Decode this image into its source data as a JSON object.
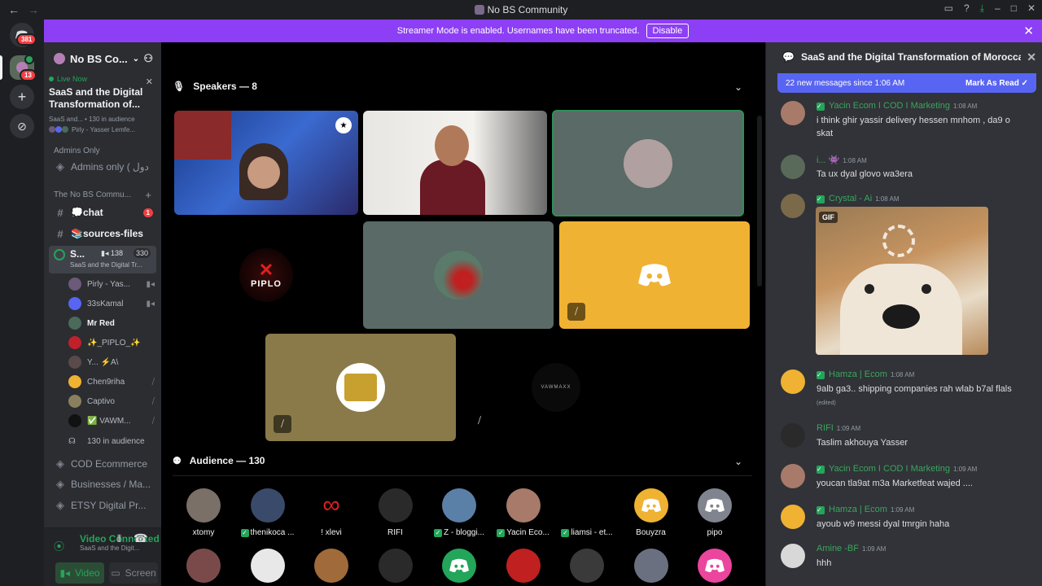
{
  "window": {
    "title": "No BS Community"
  },
  "banner": {
    "text": "Streamer Mode is enabled. Usernames have been truncated.",
    "disable_label": "Disable"
  },
  "guilds": {
    "home_badge": "381",
    "server_badge": "13"
  },
  "sidebar": {
    "server_name": "No BS Co...",
    "live_label": "Live Now",
    "stage_title": "SaaS and the Digital Transformation of...",
    "stage_meta_1": "SaaS and...",
    "stage_meta_audience": "130 in audience",
    "stage_meta_2": "Pirly - Yasser Lemfe...",
    "admins_cat": "Admins Only",
    "admins_channel": "Admins only ( ﺩﻭﻝ",
    "community_cat": "The No BS Commu...",
    "channels": [
      {
        "name": "💭chat",
        "badge": "1"
      },
      {
        "name": "📚sources-files"
      }
    ],
    "active_channel": {
      "name": "S...",
      "video_count": "138",
      "count": "330",
      "sub": "SaaS and the Digital Tr..."
    },
    "members": [
      {
        "name": "Pirly - Yas...",
        "color": "#6b5a7a"
      },
      {
        "name": "33sKamal",
        "color": "#5865f2"
      },
      {
        "name": "Mr Red",
        "color": "#4a6a5a",
        "bold": true
      },
      {
        "name": "✨_PIPLO_✨",
        "color": "#c0202a"
      },
      {
        "name": "Y... ⚡A\\",
        "color": "#5a4a4a"
      },
      {
        "name": "Chen9riha",
        "color": "#f0b232"
      },
      {
        "name": "Captivo",
        "color": "#8a8060"
      },
      {
        "name": "✅ VAWM...",
        "color": "#111111"
      }
    ],
    "audience_label": "130 in audience",
    "other_channels": [
      "COD Ecommerce",
      "Businesses / Ma...",
      "ETSY Digital Pr..."
    ],
    "voice_status": "Video Connected",
    "voice_sub": "SaaS and the Digit...",
    "video_btn": "Video",
    "screen_btn": "Screen"
  },
  "stage": {
    "speakers_label": "Speakers — 8",
    "audience_label": "Audience — 130",
    "piplo_text": "PIPLO",
    "vawmaxx_text": "VAWMAXX",
    "audience": [
      {
        "name": "xtomy",
        "color": "#7a7068",
        "check": false
      },
      {
        "name": "thenikoca ...",
        "color": "#3a4a6a",
        "check": true
      },
      {
        "name": "! xlevi",
        "color": "#000000",
        "check": false,
        "infinity": true
      },
      {
        "name": "RIFI",
        "color": "#2a2a2a",
        "check": false
      },
      {
        "name": "Z - bloggi...",
        "color": "#5a80a8",
        "check": true
      },
      {
        "name": "Yacin Eco...",
        "color": "#a87a6a",
        "check": true
      },
      {
        "name": "liamsi - et...",
        "color": "#000000",
        "check": true
      },
      {
        "name": "Bouyzra",
        "color": "#f0b232",
        "check": false,
        "discord": true
      },
      {
        "name": "pipo",
        "color": "#80848e",
        "check": false,
        "discord": true
      }
    ],
    "audience_row2": [
      "#7a4a4a",
      "#e8e8e8",
      "#a06a3a",
      "#2a2a2a",
      "#23a55a",
      "#c02020",
      "#3a3a3a",
      "#6a7080",
      "#eb459e"
    ]
  },
  "chat": {
    "title": "SaaS and the Digital Transformation of Moroccan In",
    "new_messages": "22 new messages since 1:06 AM",
    "mark_read": "Mark As Read",
    "gif_label": "GIF",
    "messages": [
      {
        "author": "Yacin Ecom I COD I Marketing",
        "time": "1:08 AM",
        "text": "i think ghir yassir delivery hessen mnhom , da9 o skat",
        "color": "#3ba55d",
        "check": true,
        "avatar": "#a87a6a"
      },
      {
        "author": "i... 👾",
        "time": "1:08 AM",
        "text": "Ta ux dyal glovo wa3era",
        "color": "#3ba55d",
        "check": false,
        "avatar": "#5a6a5a"
      },
      {
        "author": "Crystal - Ai",
        "time": "1:08 AM",
        "text": "",
        "color": "#3ba55d",
        "check": true,
        "avatar": "#7a6a4a"
      },
      {
        "author": "Hamza | Ecom",
        "time": "1:08 AM",
        "text": "9alb ga3.. shipping companies rah wlab b7al flals",
        "edited": "(edited)",
        "color": "#3ba55d",
        "check": true,
        "avatar": "#f0b232"
      },
      {
        "author": "RIFI",
        "time": "1:09 AM",
        "text": "Taslim akhouya Yasser",
        "color": "#3ba55d",
        "check": false,
        "avatar": "#2a2a2a"
      },
      {
        "author": "Yacin Ecom I COD I Marketing",
        "time": "1:09 AM",
        "text": "youcan tla9at m3a Marketfeat wajed ....",
        "color": "#3ba55d",
        "check": true,
        "avatar": "#a87a6a"
      },
      {
        "author": "Hamza | Ecom",
        "time": "1:09 AM",
        "text": "ayoub w9 messi dyal tmrgin haha",
        "color": "#3ba55d",
        "check": true,
        "avatar": "#f0b232"
      },
      {
        "author": "Amine -BF",
        "time": "1:09 AM",
        "text": "hhh",
        "color": "#3ba55d",
        "check": false,
        "avatar": "#d8d8d8"
      }
    ]
  }
}
